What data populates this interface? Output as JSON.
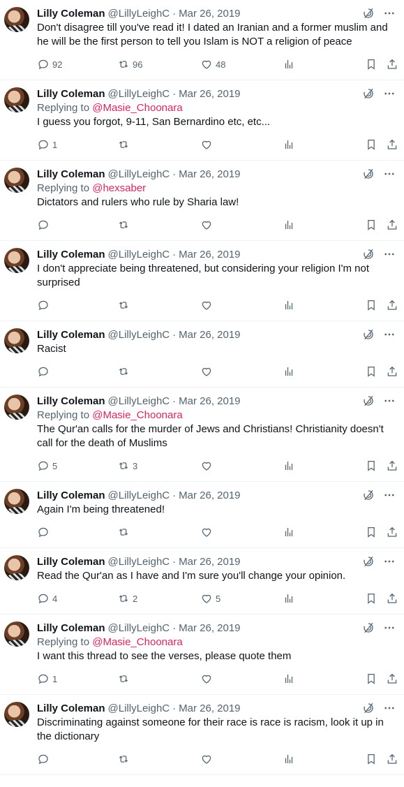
{
  "colors": {
    "mention": "#e0245e",
    "muted": "#536471",
    "text": "#0f1419",
    "divider": "#eff3f4"
  },
  "tweets": [
    {
      "name": "Lilly Coleman",
      "handle": "@LillyLeighC",
      "date": "Mar 26, 2019",
      "reply_prefix": "",
      "reply_to": "",
      "text": "Don't disagree till you've read it! I dated an Iranian and a former muslim and he will be the first person to tell you Islam is NOT a religion of peace",
      "replies": "92",
      "retweets": "96",
      "likes": "48"
    },
    {
      "name": "Lilly Coleman",
      "handle": "@LillyLeighC",
      "date": "Mar 26, 2019",
      "reply_prefix": "Replying to",
      "reply_to": "@Masie_Choonara",
      "text": "I guess you forgot, 9-11, San Bernardino etc, etc...",
      "replies": "1",
      "retweets": "",
      "likes": ""
    },
    {
      "name": "Lilly Coleman",
      "handle": "@LillyLeighC",
      "date": "Mar 26, 2019",
      "reply_prefix": "Replying to",
      "reply_to": "@hexsaber",
      "text": "Dictators and rulers who rule by Sharia law!",
      "replies": "",
      "retweets": "",
      "likes": ""
    },
    {
      "name": "Lilly Coleman",
      "handle": "@LillyLeighC",
      "date": "Mar 26, 2019",
      "reply_prefix": "",
      "reply_to": "",
      "text": "I don't appreciate being threatened, but considering your religion I'm not surprised",
      "replies": "",
      "retweets": "",
      "likes": ""
    },
    {
      "name": "Lilly Coleman",
      "handle": "@LillyLeighC",
      "date": "Mar 26, 2019",
      "reply_prefix": "",
      "reply_to": "",
      "text": "Racist",
      "replies": "",
      "retweets": "",
      "likes": ""
    },
    {
      "name": "Lilly Coleman",
      "handle": "@LillyLeighC",
      "date": "Mar 26, 2019",
      "reply_prefix": "Replying to",
      "reply_to": "@Masie_Choonara",
      "text": "The Qur'an calls for the murder of Jews and Christians! Christianity doesn't call for the death of Muslims",
      "replies": "5",
      "retweets": "3",
      "likes": ""
    },
    {
      "name": "Lilly Coleman",
      "handle": "@LillyLeighC",
      "date": "Mar 26, 2019",
      "reply_prefix": "",
      "reply_to": "",
      "text": "Again I'm being threatened!",
      "replies": "",
      "retweets": "",
      "likes": ""
    },
    {
      "name": "Lilly Coleman",
      "handle": "@LillyLeighC",
      "date": "Mar 26, 2019",
      "reply_prefix": "",
      "reply_to": "",
      "text": "Read the Qur'an as I have and I'm sure you'll change your opinion.",
      "replies": "4",
      "retweets": "2",
      "likes": "5"
    },
    {
      "name": "Lilly Coleman",
      "handle": "@LillyLeighC",
      "date": "Mar 26, 2019",
      "reply_prefix": "Replying to",
      "reply_to": "@Masie_Choonara",
      "text": "I want this thread to see the verses, please quote them",
      "replies": "1",
      "retweets": "",
      "likes": ""
    },
    {
      "name": "Lilly Coleman",
      "handle": "@LillyLeighC",
      "date": "Mar 26, 2019",
      "reply_prefix": "",
      "reply_to": "",
      "text": "Discriminating against someone for their race is race is racism, look it up in the dictionary",
      "replies": "",
      "retweets": "",
      "likes": ""
    }
  ]
}
